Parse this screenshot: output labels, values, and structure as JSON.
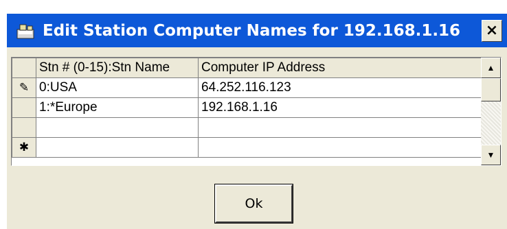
{
  "window": {
    "title": "Edit Station Computer Names for 192.168.1.16",
    "close_label": "×",
    "title_icon": "app-window-icon",
    "colors": {
      "titlebar": "#0d58d8",
      "face": "#ece9d8"
    }
  },
  "grid": {
    "columns": [
      "Stn # (0-15):Stn Name",
      "Computer IP Address"
    ],
    "rows": [
      {
        "marker": "✎",
        "station": "0:USA",
        "ip": "64.252.116.123"
      },
      {
        "marker": "",
        "station": "1:*Europe",
        "ip": "192.168.1.16"
      },
      {
        "marker": "",
        "station": "",
        "ip": ""
      },
      {
        "marker": "✱",
        "station": "",
        "ip": ""
      }
    ],
    "scroll_up": "▲",
    "scroll_down": "▼"
  },
  "buttons": {
    "ok_label": "Ok"
  }
}
